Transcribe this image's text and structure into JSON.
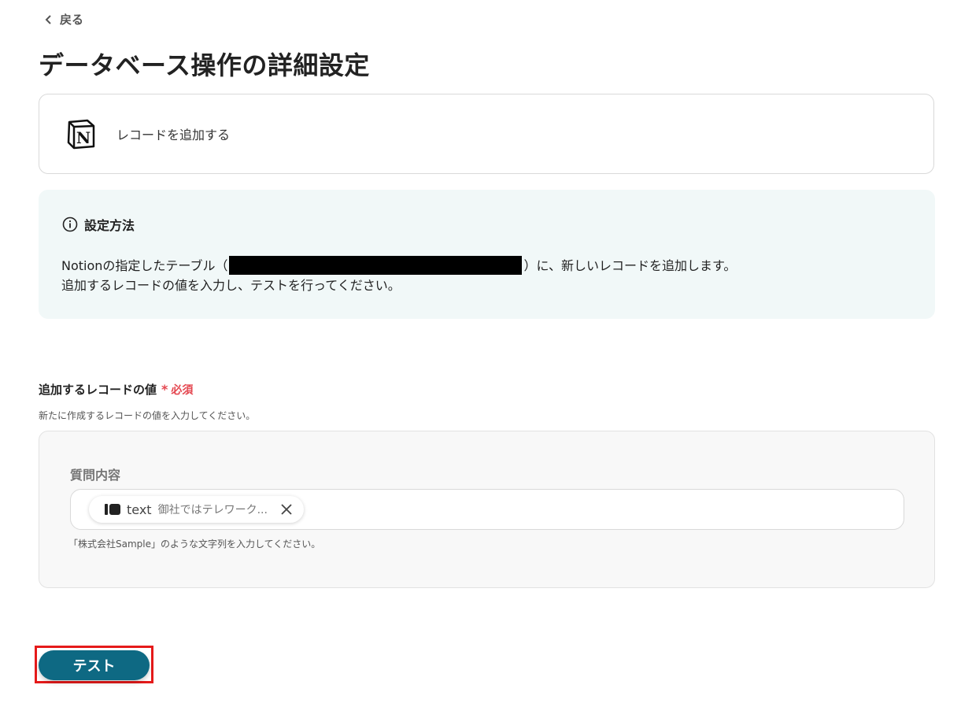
{
  "nav": {
    "back_label": "戻る"
  },
  "page": {
    "title": "データベース操作の詳細設定"
  },
  "action": {
    "label": "レコードを追加する",
    "app_icon": "notion-logo"
  },
  "info": {
    "heading": "設定方法",
    "line1_before": "Notionの指定したテーブル（",
    "line1_after": "）に、新しいレコードを追加します。",
    "line2": "追加するレコードの値を入力し、テストを行ってください。"
  },
  "field": {
    "label": "追加するレコードの値",
    "required_marker": "*",
    "required_text": "必須",
    "help": "新たに作成するレコードの値を入力してください。",
    "sub_label": "質問内容",
    "chip": {
      "field": "text",
      "preview": "御社ではテレワーク..."
    },
    "hint": "「株式会社Sample」のような文字列を入力してください。"
  },
  "test_button": {
    "label": "テスト",
    "color": "#0e6983",
    "highlight_color": "#e51a1a"
  }
}
